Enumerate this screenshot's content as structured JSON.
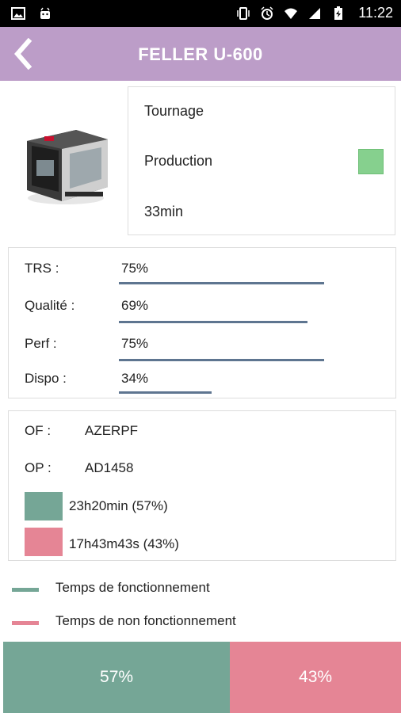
{
  "status_bar": {
    "time": "11:22"
  },
  "header": {
    "title": "FELLER U-600"
  },
  "machine_info": {
    "operation": "Tournage",
    "state": "Production",
    "state_color": "#86d08e",
    "duration": "33min"
  },
  "kpis": [
    {
      "label": "TRS :",
      "value": "75%",
      "fraction": 0.75
    },
    {
      "label": "Qualité :",
      "value": "69%",
      "fraction": 0.69
    },
    {
      "label": "Perf :",
      "value": "75%",
      "fraction": 0.75
    },
    {
      "label": "Dispo :",
      "value": "34%",
      "fraction": 0.34
    }
  ],
  "order": {
    "of_label": "OF :",
    "of_value": "AZERPF",
    "op_label": "OP :",
    "op_value": "AD1458",
    "running_time": "23h20min (57%)",
    "stopped_time": "17h43m43s (43%)"
  },
  "legend": {
    "running": "Temps de fonctionnement",
    "stopped": "Temps de non fonctionnement"
  },
  "colors": {
    "running": "#75a696",
    "stopped": "#e58595",
    "kpi_bar": "#5e7590",
    "header": "#bc9dc8"
  },
  "summary": {
    "running_pct_label": "57%",
    "stopped_pct_label": "43%",
    "running_fraction": 0.57,
    "stopped_fraction": 0.43
  }
}
